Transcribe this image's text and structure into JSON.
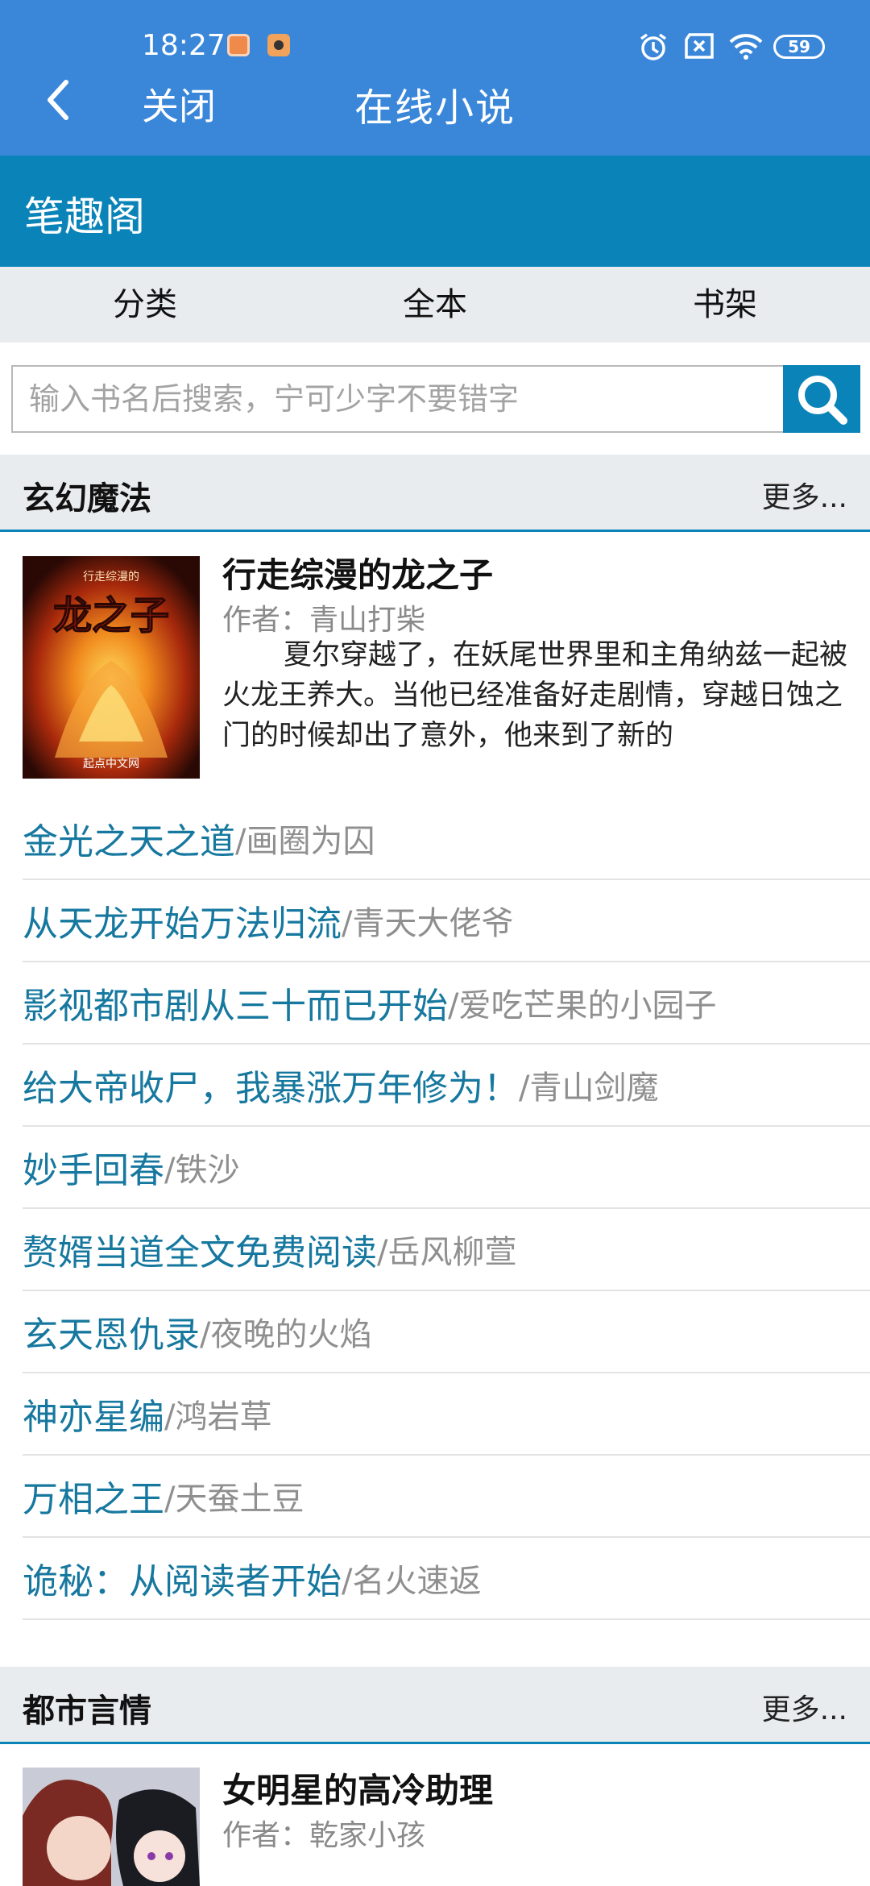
{
  "status_bar": {
    "time": "18:27",
    "battery": "59"
  },
  "appbar": {
    "close_label": "关闭",
    "title": "在线小说"
  },
  "site": {
    "name": "笔趣阁"
  },
  "nav": [
    "分类",
    "全本",
    "书架"
  ],
  "search": {
    "placeholder": "输入书名后搜索，宁可少字不要错字"
  },
  "sections": [
    {
      "title": "玄幻魔法",
      "more": "更多...",
      "featured": {
        "title": "行走综漫的龙之子",
        "author": "作者：青山打柴",
        "description": "夏尔穿越了，在妖尾世界里和主角纳兹一起被火龙王养大。当他已经准备好走剧情，穿越日蚀之门的时候却出了意外，他来到了新的",
        "cover_small_text": "行走综漫的",
        "cover_title": "龙之子",
        "cover_publisher": "起点中文网"
      },
      "books": [
        {
          "title": "金光之天之道",
          "author": "/画圈为囚"
        },
        {
          "title": "从天龙开始万法归流",
          "author": "/青天大佬爷"
        },
        {
          "title": "影视都市剧从三十而已开始",
          "author": "/爱吃芒果的小园子"
        },
        {
          "title": "给大帝收尸，我暴涨万年修为！",
          "author": "/青山剑魔"
        },
        {
          "title": "妙手回春",
          "author": "/铁沙"
        },
        {
          "title": "赘婿当道全文免费阅读",
          "author": "/岳风柳萱"
        },
        {
          "title": "玄天恩仇录",
          "author": "/夜晚的火焰"
        },
        {
          "title": "神亦星编",
          "author": "/鸿岩草"
        },
        {
          "title": "万相之王",
          "author": "/天蚕土豆"
        },
        {
          "title": "诡秘：从阅读者开始",
          "author": "/名火速返"
        }
      ]
    },
    {
      "title": "都市言情",
      "more": "更多...",
      "featured": {
        "title": "女明星的高冷助理",
        "author": "作者：乾家小孩"
      }
    }
  ],
  "colors": {
    "appbar": "#3a87d9",
    "site_header": "#0a84b8",
    "link": "#17789f"
  },
  "icons": [
    "back-arrow-icon",
    "alarm-icon",
    "sim-icon",
    "wifi-icon",
    "battery-icon",
    "search-icon"
  ]
}
